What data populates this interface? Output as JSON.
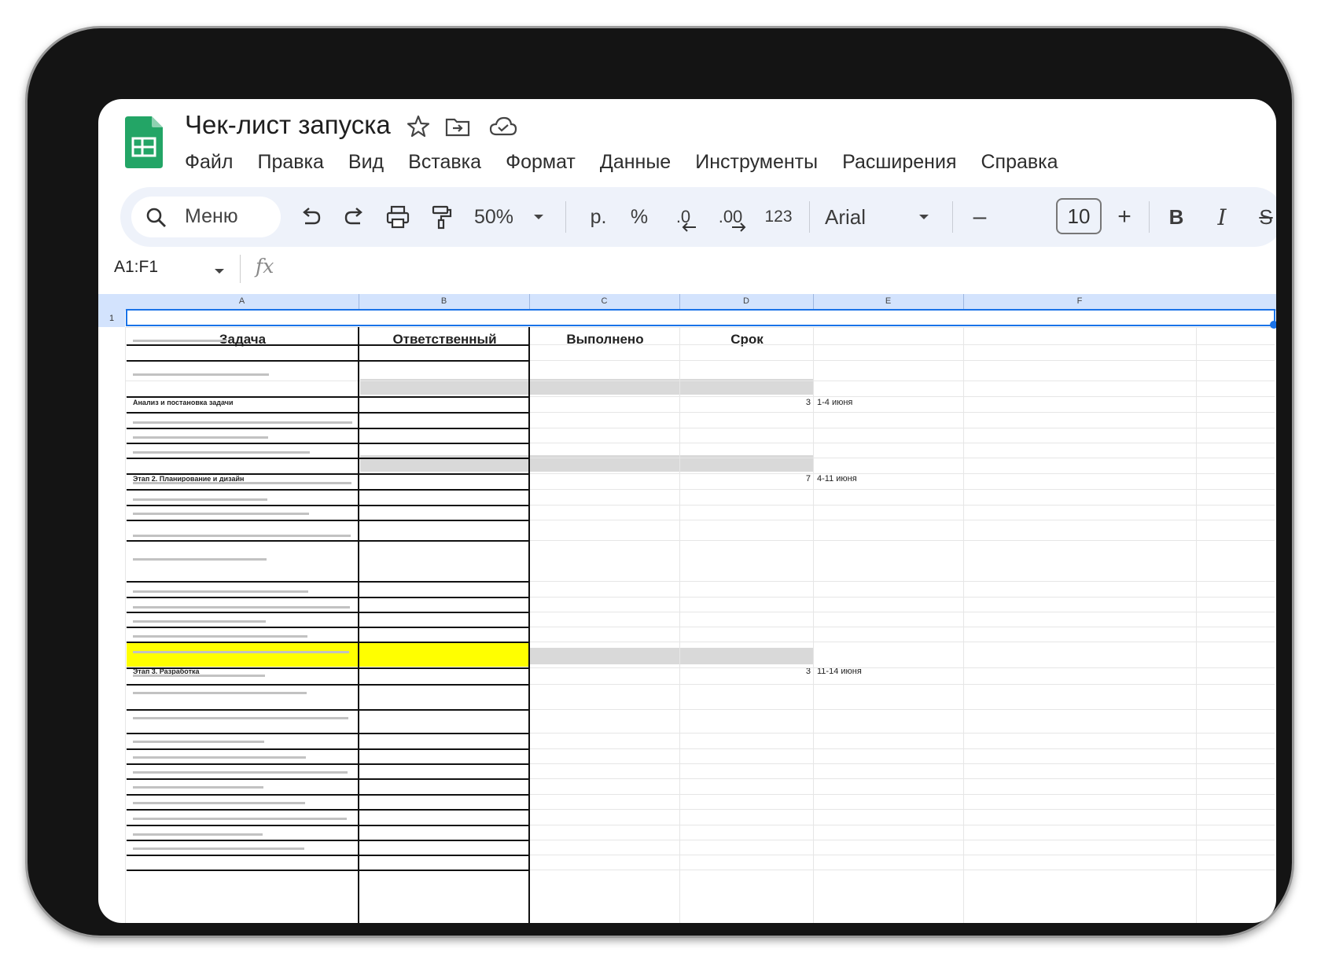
{
  "app": {
    "title": "Чек-лист запуска",
    "icons": [
      "star-icon",
      "move-folder-icon",
      "cloud-saved-icon"
    ],
    "menu": [
      "Файл",
      "Правка",
      "Вид",
      "Вставка",
      "Формат",
      "Данные",
      "Инструменты",
      "Расширения",
      "Справка"
    ]
  },
  "toolbar": {
    "search_label": "Меню",
    "zoom": "50%",
    "currency": "р.",
    "percent": "%",
    "dec_decrease": ".0",
    "dec_increase": ".00",
    "number_format": "123",
    "font": "Arial",
    "font_size": "10",
    "minus": "–",
    "plus": "+",
    "bold": "B",
    "italic": "I",
    "strike": "S"
  },
  "formula_bar": {
    "name_box": "A1:F1",
    "fx": "fx"
  },
  "sheet": {
    "columns": [
      "A",
      "B",
      "C",
      "D",
      "E",
      "F"
    ],
    "row1_label": "1",
    "headers": {
      "task": "Задача",
      "owner": "Ответственный",
      "done": "Выполнено",
      "deadline": "Срок"
    },
    "phase_rows": [
      {
        "label": "Анализ и постановка задачи",
        "days": "3",
        "dates": "1-4 июня"
      },
      {
        "label": "Этап 2. Планирование и дизайн",
        "days": "7",
        "dates": "4-11 июня"
      },
      {
        "label": "Этап 3. Разработка",
        "days": "3",
        "dates": "11-14 июня"
      }
    ]
  },
  "colors": {
    "accent": "#1a73e8",
    "header_fill": "#d3e3fd",
    "phase_fill": "#d9d9d9",
    "highlight": "#ffff00"
  }
}
